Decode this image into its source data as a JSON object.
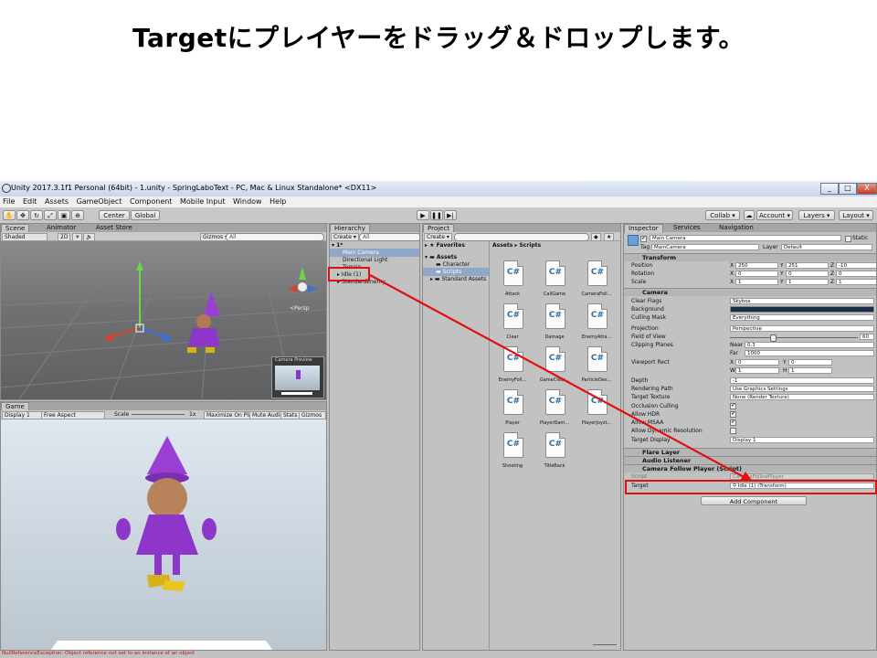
{
  "heading": "Targetにプレイヤーをドラッグ＆ドロップします。",
  "window": {
    "title": "Unity 2017.3.1f1 Personal (64bit) - 1.unity - SpringLaboText - PC, Mac & Linux Standalone* <DX11>",
    "min": "_",
    "max": "□",
    "close": "X"
  },
  "menu": [
    "File",
    "Edit",
    "Assets",
    "GameObject",
    "Component",
    "Mobile Input",
    "Window",
    "Help"
  ],
  "toolbar": {
    "center": "Center",
    "global": "Global",
    "play": "▶",
    "pause": "❚❚",
    "step": "▶|",
    "collab": "Collab ▾",
    "account": "Account ▾",
    "layers": "Layers ▾",
    "layout": "Layout ▾"
  },
  "scene": {
    "tabs": [
      "Scene",
      "Animator",
      "Asset Store"
    ],
    "shaded": "Shaded",
    "twod": "2D",
    "gizmos": "Gizmos ▾",
    "search": "All",
    "persp": "<Persp",
    "camera_preview": "Camera Preview"
  },
  "game": {
    "tab": "Game",
    "display": "Display 1",
    "aspect": "Free Aspect",
    "scale_label": "Scale",
    "scale_value": "1x",
    "maximize": "Maximize On Play",
    "mute": "Mute Audio",
    "stats": "Stats",
    "gizmos": "Gizmos ▾"
  },
  "hierarchy": {
    "tab": "Hierarchy",
    "create": "Create ▾",
    "search": "All",
    "scene": "1*",
    "items": [
      "Main Camera",
      "Directional Light",
      "Terrain",
      "Idle (1)",
      "StandardEnemy"
    ],
    "selected_index": 0
  },
  "project": {
    "tab": "Project",
    "create": "Create ▾",
    "favorites": "Favorites",
    "assets": "Assets",
    "folders": [
      "Character",
      "Scripts",
      "Standard Assets"
    ],
    "selected_folder": "Scripts",
    "breadcrumb": "Assets ▸ Scripts",
    "scripts": [
      "Attack",
      "CallGame",
      "CameraFoll...",
      "Clear",
      "Damage",
      "EnemyAtta...",
      "EnemyFoll...",
      "GameClear...",
      "ParticleDes...",
      "Player",
      "PlayerDam...",
      "PlayerJoyst...",
      "Shooting",
      "TitleBack"
    ],
    "cs_label": "C#"
  },
  "inspector": {
    "tabs": [
      "Inspector",
      "Services",
      "Navigation"
    ],
    "object_name": "Main Camera",
    "static_label": "Static",
    "tag_label": "Tag",
    "tag_value": "MainCamera",
    "layer_label": "Layer",
    "layer_value": "Default",
    "transform": {
      "title": "Transform",
      "rows": [
        {
          "label": "Position",
          "x": "250",
          "y": "251",
          "z": "-10"
        },
        {
          "label": "Rotation",
          "x": "0",
          "y": "0",
          "z": "0"
        },
        {
          "label": "Scale",
          "x": "1",
          "y": "1",
          "z": "1"
        }
      ]
    },
    "camera": {
      "title": "Camera",
      "clear_flags": "Skybox",
      "background": "#1a2d47",
      "culling_mask": "Everything",
      "projection": "Perspective",
      "fov": "60",
      "near": "0.3",
      "far": "1000",
      "viewport": {
        "x": "0",
        "y": "0",
        "w": "1",
        "h": "1"
      },
      "depth": "-1",
      "rendering_path": "Use Graphics Settings",
      "target_texture": "None (Render Texture)",
      "target_display": "Display 1",
      "labels": [
        "Clear Flags",
        "Background",
        "Culling Mask",
        "Projection",
        "Field of View",
        "Clipping Planes",
        "Viewport Rect",
        "Depth",
        "Rendering Path",
        "Target Texture",
        "Occlusion Culling",
        "Allow HDR",
        "Allow MSAA",
        "Allow Dynamic Resolution",
        "Target Display"
      ],
      "near_label": "Near",
      "far_label": "Far"
    },
    "flare_layer": "Flare Layer",
    "audio_listener": "Audio Listener",
    "follow_script": "Camera Follow Player (Script)",
    "script_label": "Script",
    "script_value": "CameraFollowPlayer",
    "target_label": "Target",
    "target_value": "Idle (1) (Transform)",
    "add_component": "Add Component"
  },
  "console": "NullReferenceException: Object reference not set to an instance of an object",
  "accent_red": "#e01010"
}
